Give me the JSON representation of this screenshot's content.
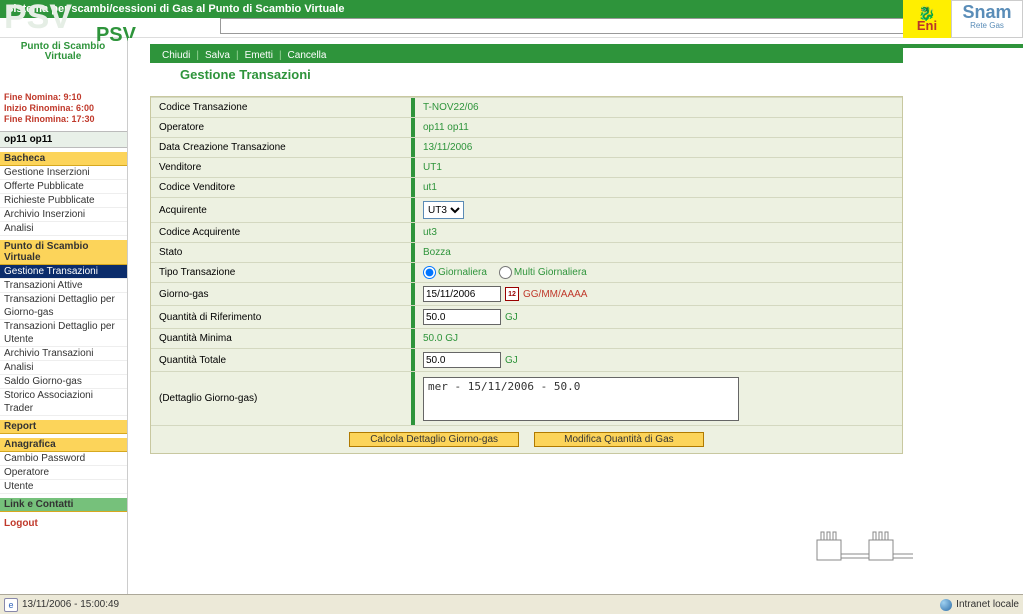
{
  "header": {
    "system_title": "Sistema per scambi/cessioni di Gas al Punto di Scambio Virtuale"
  },
  "branding": {
    "psv_big": "PSV",
    "psv_small": "PSV",
    "psv_sub": "Punto di Scambio Virtuale",
    "eni": "Eni",
    "snam": "Snam",
    "snam_sub": "Rete Gas"
  },
  "timers": {
    "fine_nomina": "Fine Nomina: 9:10",
    "inizio_rinomina": "Inizio Rinomina: 6:00",
    "fine_rinomina": "Fine Rinomina: 17:30"
  },
  "user": {
    "label": "op11 op11"
  },
  "menu": {
    "bacheca": {
      "title": "Bacheca",
      "items": [
        "Gestione Inserzioni",
        "Offerte Pubblicate",
        "Richieste Pubblicate",
        "Archivio Inserzioni",
        "Analisi"
      ]
    },
    "psv": {
      "title": "Punto di Scambio Virtuale",
      "items": [
        "Gestione Transazioni",
        "Transazioni Attive",
        "Transazioni Dettaglio per Giorno-gas",
        "Transazioni Dettaglio per Utente",
        "Archivio Transazioni",
        "Analisi",
        "Saldo Giorno-gas",
        "Storico Associazioni Trader"
      ],
      "selected_index": 0
    },
    "report": {
      "title": "Report"
    },
    "anagrafica": {
      "title": "Anagrafica",
      "items": [
        "Cambio Password",
        "Operatore",
        "Utente"
      ]
    },
    "link": {
      "title": "Link e Contatti"
    },
    "logout": "Logout"
  },
  "actions": {
    "chiudi": "Chiudi",
    "salva": "Salva",
    "emetti": "Emetti",
    "cancella": "Cancella"
  },
  "page": {
    "title": "Gestione Transazioni"
  },
  "form": {
    "codice_transazione": {
      "label": "Codice Transazione",
      "value": "T-NOV22/06"
    },
    "operatore": {
      "label": "Operatore",
      "value": "op11 op11"
    },
    "data_creazione": {
      "label": "Data Creazione Transazione",
      "value": "13/11/2006"
    },
    "venditore": {
      "label": "Venditore",
      "value": "UT1"
    },
    "codice_venditore": {
      "label": "Codice Venditore",
      "value": "ut1"
    },
    "acquirente": {
      "label": "Acquirente",
      "value": "UT3"
    },
    "codice_acquirente": {
      "label": "Codice Acquirente",
      "value": "ut3"
    },
    "stato": {
      "label": "Stato",
      "value": "Bozza"
    },
    "tipo_transazione": {
      "label": "Tipo Transazione",
      "giornaliera": "Giornaliera",
      "multi": "Multi Giornaliera"
    },
    "giorno_gas": {
      "label": "Giorno-gas",
      "value": "15/11/2006",
      "hint": "GG/MM/AAAA"
    },
    "quantita_rif": {
      "label": "Quantità di Riferimento",
      "value": "50.0",
      "unit": "GJ"
    },
    "quantita_min": {
      "label": "Quantità Minima",
      "value": "50.0 GJ"
    },
    "quantita_tot": {
      "label": "Quantità Totale",
      "value": "50.0",
      "unit": "GJ"
    },
    "dettaglio": {
      "label": "(Dettaglio Giorno-gas)",
      "value": "mer - 15/11/2006 - 50.0"
    }
  },
  "buttons": {
    "calcola": "Calcola Dettaglio Giorno-gas",
    "modifica": "Modifica Quantità di Gas"
  },
  "status": {
    "datetime": "13/11/2006 - 15:00:49",
    "zone": "Intranet locale"
  }
}
